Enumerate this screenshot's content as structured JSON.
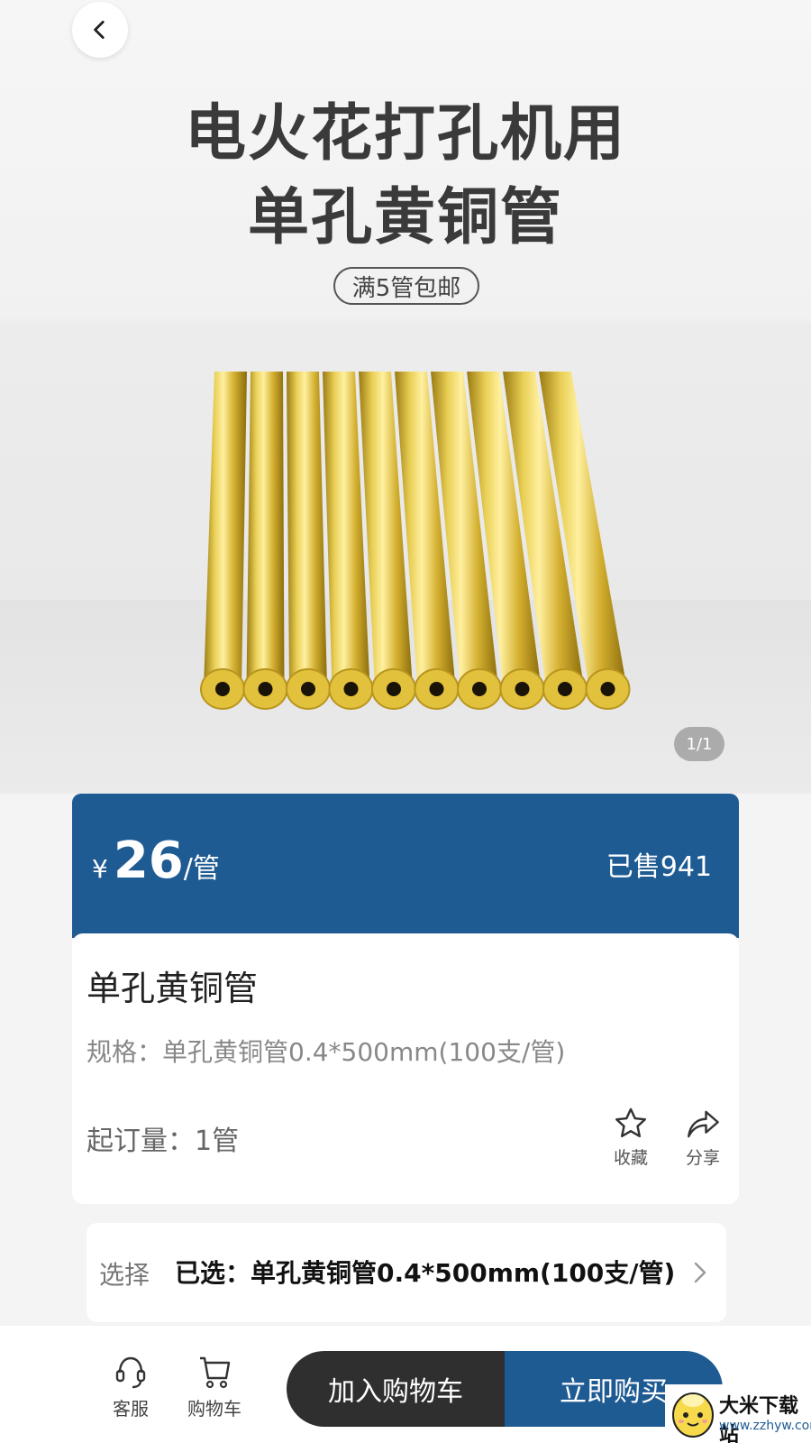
{
  "hero": {
    "title_line1": "电火花打孔机用",
    "title_line2": "单孔黄铜管",
    "promo": "满5管包邮",
    "image_counter": "1/1",
    "image_subject": "brass-tubes"
  },
  "price": {
    "currency": "¥",
    "amount": "26",
    "unit": "/管",
    "sold": "已售941"
  },
  "product": {
    "name": "单孔黄铜管",
    "spec": "规格：单孔黄铜管0.4*500mm(100支/管)",
    "moq": "起订量：1管",
    "favorite_label": "收藏",
    "share_label": "分享"
  },
  "select": {
    "label": "选择",
    "value": "已选：单孔黄铜管0.4*500mm(100支/管)"
  },
  "bottom": {
    "service_label": "客服",
    "cart_label": "购物车",
    "add_to_cart": "加入购物车",
    "buy_now": "立即购买"
  },
  "watermark": {
    "name": "大米下载站",
    "url": "www.zzhyw.com"
  },
  "colors": {
    "primary_blue": "#1f5b93",
    "dark_button": "#2f2f2f",
    "brass": "#d8b43a"
  },
  "icons": {
    "back": "chevron-left-icon",
    "favorite": "star-icon",
    "share": "share-arrow-icon",
    "service": "headset-icon",
    "cart": "cart-icon",
    "select_arrow": "chevron-right-icon"
  }
}
